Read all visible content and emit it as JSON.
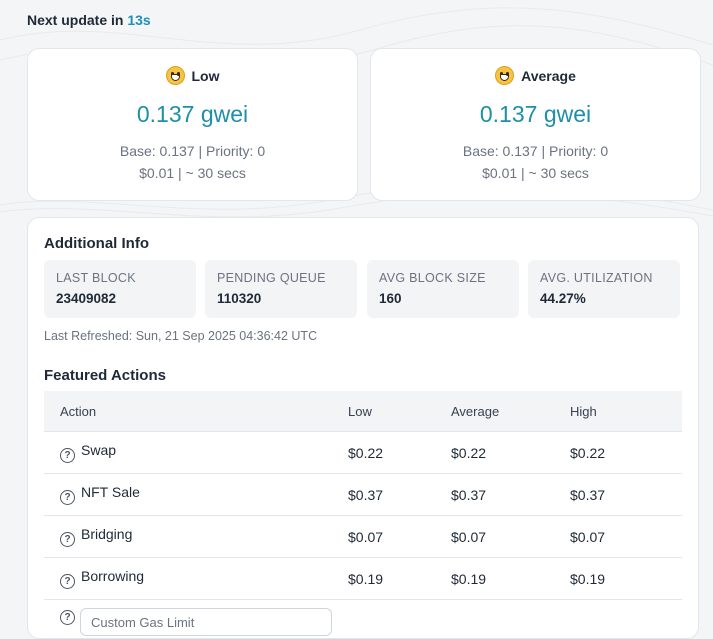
{
  "header": {
    "prefix": "Next update in",
    "countdown": "13s"
  },
  "gas_cards": [
    {
      "label": "Low",
      "icon": "grinning-face-icon",
      "value": "0.137 gwei",
      "detail": "Base: 0.137 | Priority: 0",
      "cost_time": "$0.01 | ~ 30 secs"
    },
    {
      "label": "Average",
      "icon": "smiling-face-icon",
      "value": "0.137 gwei",
      "detail": "Base: 0.137 | Priority: 0",
      "cost_time": "$0.01 | ~ 30 secs"
    }
  ],
  "additional_info": {
    "title": "Additional Info",
    "stats": [
      {
        "label": "LAST BLOCK",
        "value": "23409082"
      },
      {
        "label": "PENDING QUEUE",
        "value": "110320"
      },
      {
        "label": "AVG BLOCK SIZE",
        "value": "160"
      },
      {
        "label": "AVG. UTILIZATION",
        "value": "44.27%"
      }
    ],
    "last_refreshed": "Last Refreshed: Sun, 21 Sep 2025 04:36:42 UTC"
  },
  "featured_actions": {
    "title": "Featured Actions",
    "columns": [
      "Action",
      "Low",
      "Average",
      "High"
    ],
    "rows": [
      {
        "action": "Swap",
        "low": "$0.22",
        "average": "$0.22",
        "high": "$0.22"
      },
      {
        "action": "NFT Sale",
        "low": "$0.37",
        "average": "$0.37",
        "high": "$0.37"
      },
      {
        "action": "Bridging",
        "low": "$0.07",
        "average": "$0.07",
        "high": "$0.07"
      },
      {
        "action": "Borrowing",
        "low": "$0.19",
        "average": "$0.19",
        "high": "$0.19"
      }
    ],
    "custom_input_value": "Custom Gas Limit"
  },
  "colors": {
    "accent": "#1e8fa8",
    "countdown": "#1f8fb5",
    "background": "#f4f5f7"
  }
}
